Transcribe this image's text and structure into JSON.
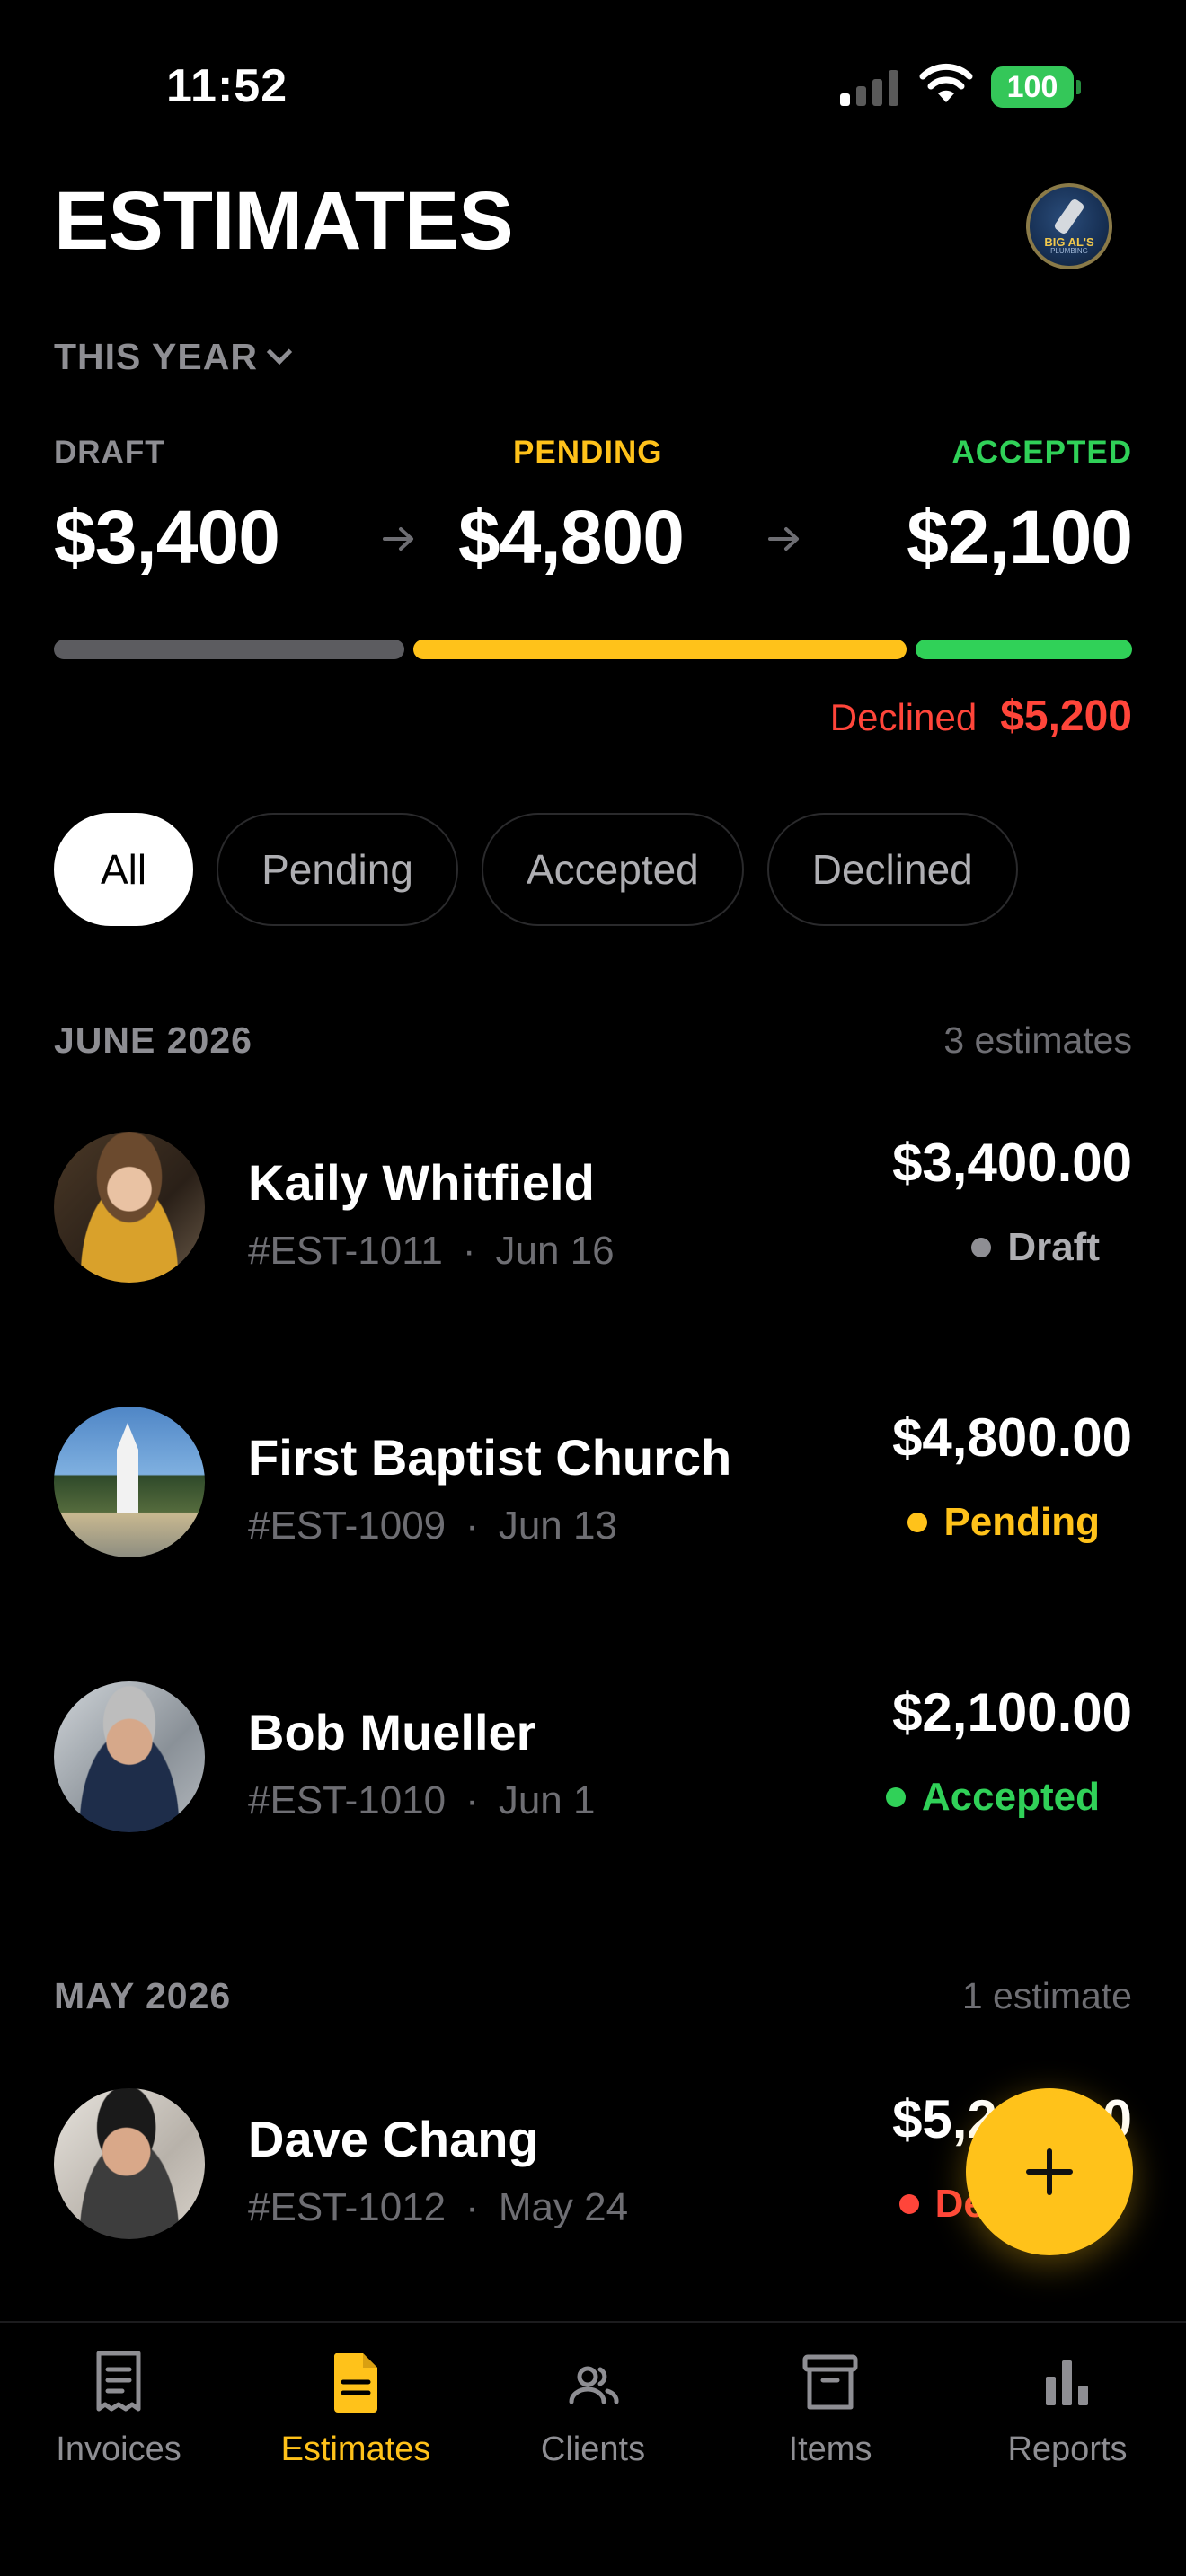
{
  "status_bar": {
    "time": "11:52",
    "battery": "100"
  },
  "header": {
    "title": "ESTIMATES",
    "period": "THIS YEAR",
    "logo_text": "BIG AL'S",
    "logo_sub": "PLUMBING"
  },
  "summary": {
    "draft": {
      "label": "DRAFT",
      "value": "$3,400"
    },
    "pending": {
      "label": "PENDING",
      "value": "$4,800"
    },
    "accepted": {
      "label": "ACCEPTED",
      "value": "$2,100"
    },
    "declined": {
      "label": "Declined",
      "value": "$5,200"
    },
    "progress_shares": {
      "draft": 3400,
      "pending": 4800,
      "accepted": 2100
    }
  },
  "colors": {
    "draft": "#5c5c60",
    "pending": "#ffc21a",
    "accepted": "#30d158",
    "declined": "#ff453a",
    "accent": "#ffc21a"
  },
  "filters": [
    "All",
    "Pending",
    "Accepted",
    "Declined"
  ],
  "sections": [
    {
      "title": "JUNE 2026",
      "count": "3 estimates",
      "rows": [
        {
          "name": "Kaily Whitfield",
          "number": "#EST-1011",
          "date": "Jun 16",
          "amount": "$3,400.00",
          "status": "Draft"
        },
        {
          "name": "First Baptist Church",
          "number": "#EST-1009",
          "date": "Jun 13",
          "amount": "$4,800.00",
          "status": "Pending"
        },
        {
          "name": "Bob Mueller",
          "number": "#EST-1010",
          "date": "Jun 1",
          "amount": "$2,100.00",
          "status": "Accepted"
        }
      ]
    },
    {
      "title": "MAY 2026",
      "count": "1 estimate",
      "rows": [
        {
          "name": "Dave Chang",
          "number": "#EST-1012",
          "date": "May 24",
          "amount": "$5,200.00",
          "status": "Declined"
        }
      ]
    }
  ],
  "meta_separator": "·",
  "tabs": [
    {
      "label": "Invoices",
      "icon": "invoice-icon"
    },
    {
      "label": "Estimates",
      "icon": "estimate-icon"
    },
    {
      "label": "Clients",
      "icon": "clients-icon"
    },
    {
      "label": "Items",
      "icon": "items-icon"
    },
    {
      "label": "Reports",
      "icon": "reports-icon"
    }
  ]
}
